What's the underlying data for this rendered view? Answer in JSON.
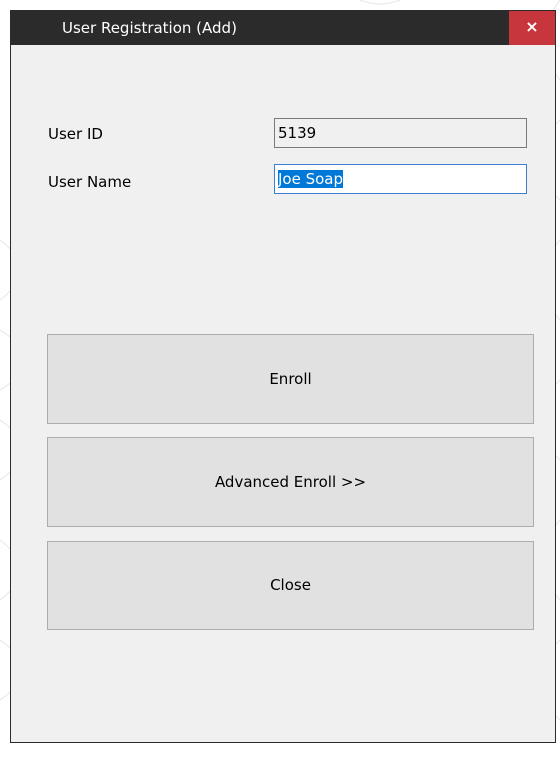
{
  "window": {
    "title": "User Registration (Add)",
    "close_glyph": "×",
    "close_icon": "close-icon"
  },
  "form": {
    "user_id_label": "User ID",
    "user_id_value": "5139",
    "user_name_label": "User Name",
    "user_name_value": "Joe Soap"
  },
  "buttons": {
    "enroll": "Enroll",
    "advanced_enroll": "Advanced Enroll >>",
    "close": "Close"
  },
  "colors": {
    "titlebar": "#2b2b2b",
    "close_button": "#c7363d",
    "selection": "#0078d7",
    "dialog_background": "#f0f0f0"
  }
}
